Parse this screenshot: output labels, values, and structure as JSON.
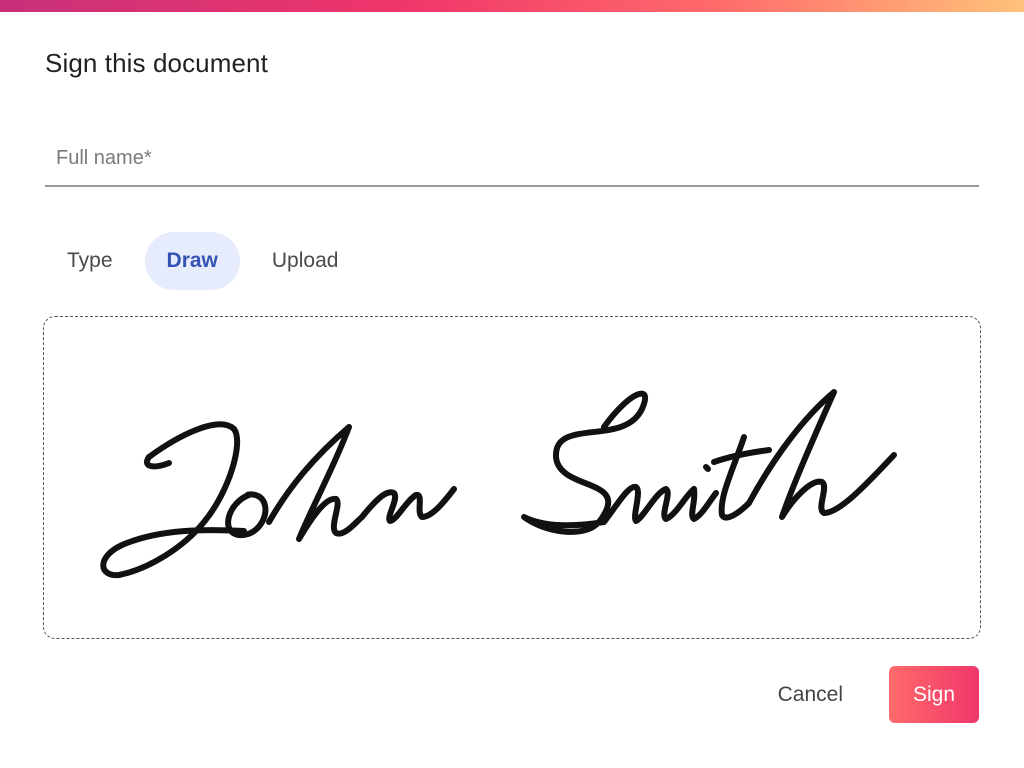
{
  "dialog": {
    "title": "Sign this document"
  },
  "full_name": {
    "placeholder": "Full name*",
    "value": ""
  },
  "tabs": [
    {
      "label": "Type",
      "active": false
    },
    {
      "label": "Draw",
      "active": true
    },
    {
      "label": "Upload",
      "active": false
    }
  ],
  "signature": {
    "text": "John Smith",
    "ink_color": "#111111"
  },
  "actions": {
    "cancel_label": "Cancel",
    "sign_label": "Sign"
  },
  "colors": {
    "accent_gradient_start": "#c8307a",
    "accent_gradient_mid": "#f0366a",
    "accent_gradient_end": "#ffc27a",
    "active_tab_bg": "#e6ecfb",
    "active_tab_text": "#3552b5",
    "sign_button": "#f0366a"
  }
}
